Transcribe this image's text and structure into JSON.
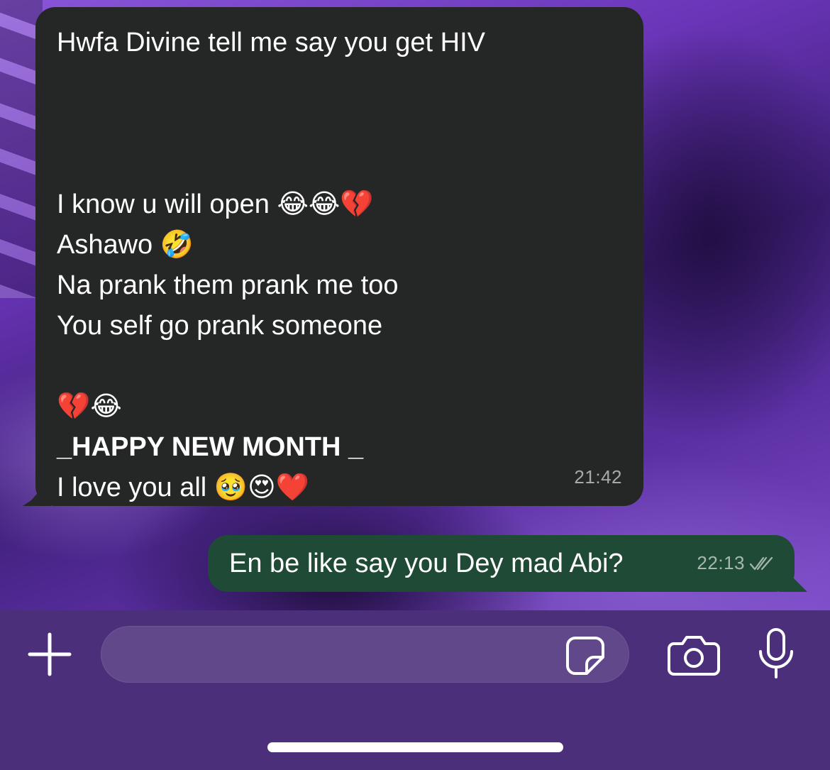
{
  "messages": {
    "incoming": {
      "lines": [
        "Hwfa Divine tell me say you get HIV",
        "",
        "",
        "",
        "I know u will open 😂😂💔",
        "Ashawo 🤣",
        "Na prank them prank me too",
        "You self go prank someone",
        "",
        "💔😂",
        "_HAPPY NEW MONTH _",
        "I love you all 🥹😍❤️"
      ],
      "time": "21:42",
      "bubble_color": "#252626"
    },
    "outgoing": {
      "text": "En be like say you Dey mad Abi?",
      "time": "22:13",
      "status_icon": "double-check-icon",
      "bubble_color": "#1f4b36"
    }
  },
  "composer": {
    "placeholder": "",
    "icons": {
      "attach": "plus-icon",
      "sticker": "sticker-icon",
      "camera": "camera-icon",
      "voice": "microphone-icon"
    }
  }
}
